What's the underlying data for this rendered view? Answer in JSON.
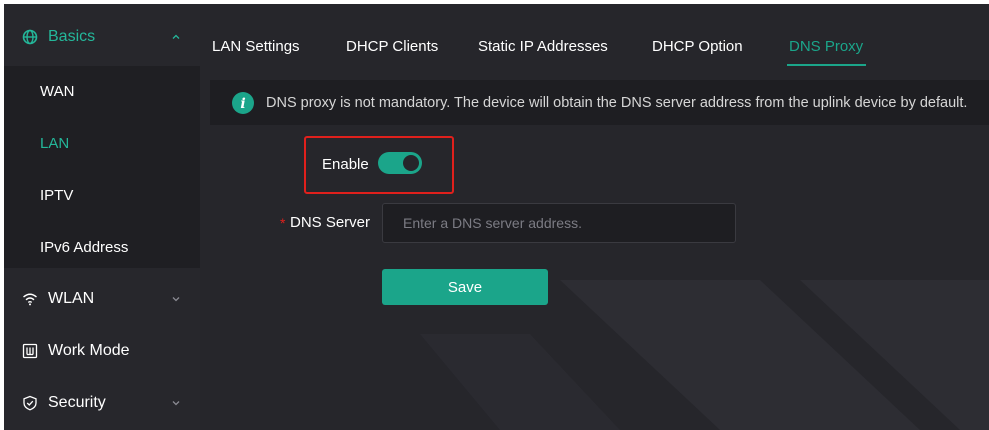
{
  "sidebar": {
    "group_basics": "Basics",
    "sub_items": [
      "WAN",
      "LAN",
      "IPTV",
      "IPv6 Address"
    ],
    "active_sub_item": "LAN",
    "group_wlan": "WLAN",
    "group_work_mode": "Work Mode",
    "group_security": "Security"
  },
  "tabs": [
    "LAN Settings",
    "DHCP Clients",
    "Static IP Addresses",
    "DHCP Option",
    "DNS Proxy"
  ],
  "active_tab": "DNS Proxy",
  "notice": {
    "text": "DNS proxy is not mandatory. The device will obtain the DNS server address from the uplink device by default."
  },
  "form": {
    "enable_label": "Enable",
    "enable_on": true,
    "required_mark": "*",
    "dns_label": "DNS Server",
    "dns_value": "",
    "dns_placeholder": "Enter a DNS server address.",
    "save_label": "Save"
  },
  "colors": {
    "accent": "#1ba58a",
    "background": "#26262b",
    "highlight_border": "#e0201c"
  }
}
